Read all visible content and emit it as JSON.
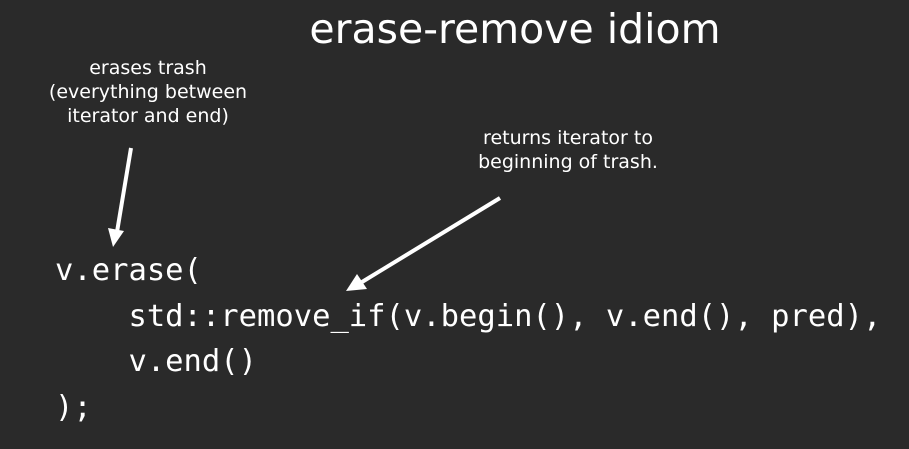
{
  "slide": {
    "title": "erase-remove idiom",
    "annotations": {
      "erase_note": [
        "erases trash",
        "(everything between",
        "iterator and end)"
      ],
      "remove_note": [
        "returns iterator to",
        "beginning of trash."
      ]
    },
    "code_lines": [
      "v.erase(",
      "    std::remove_if(v.begin(), v.end(), pred),",
      "    v.end()",
      ");"
    ]
  }
}
